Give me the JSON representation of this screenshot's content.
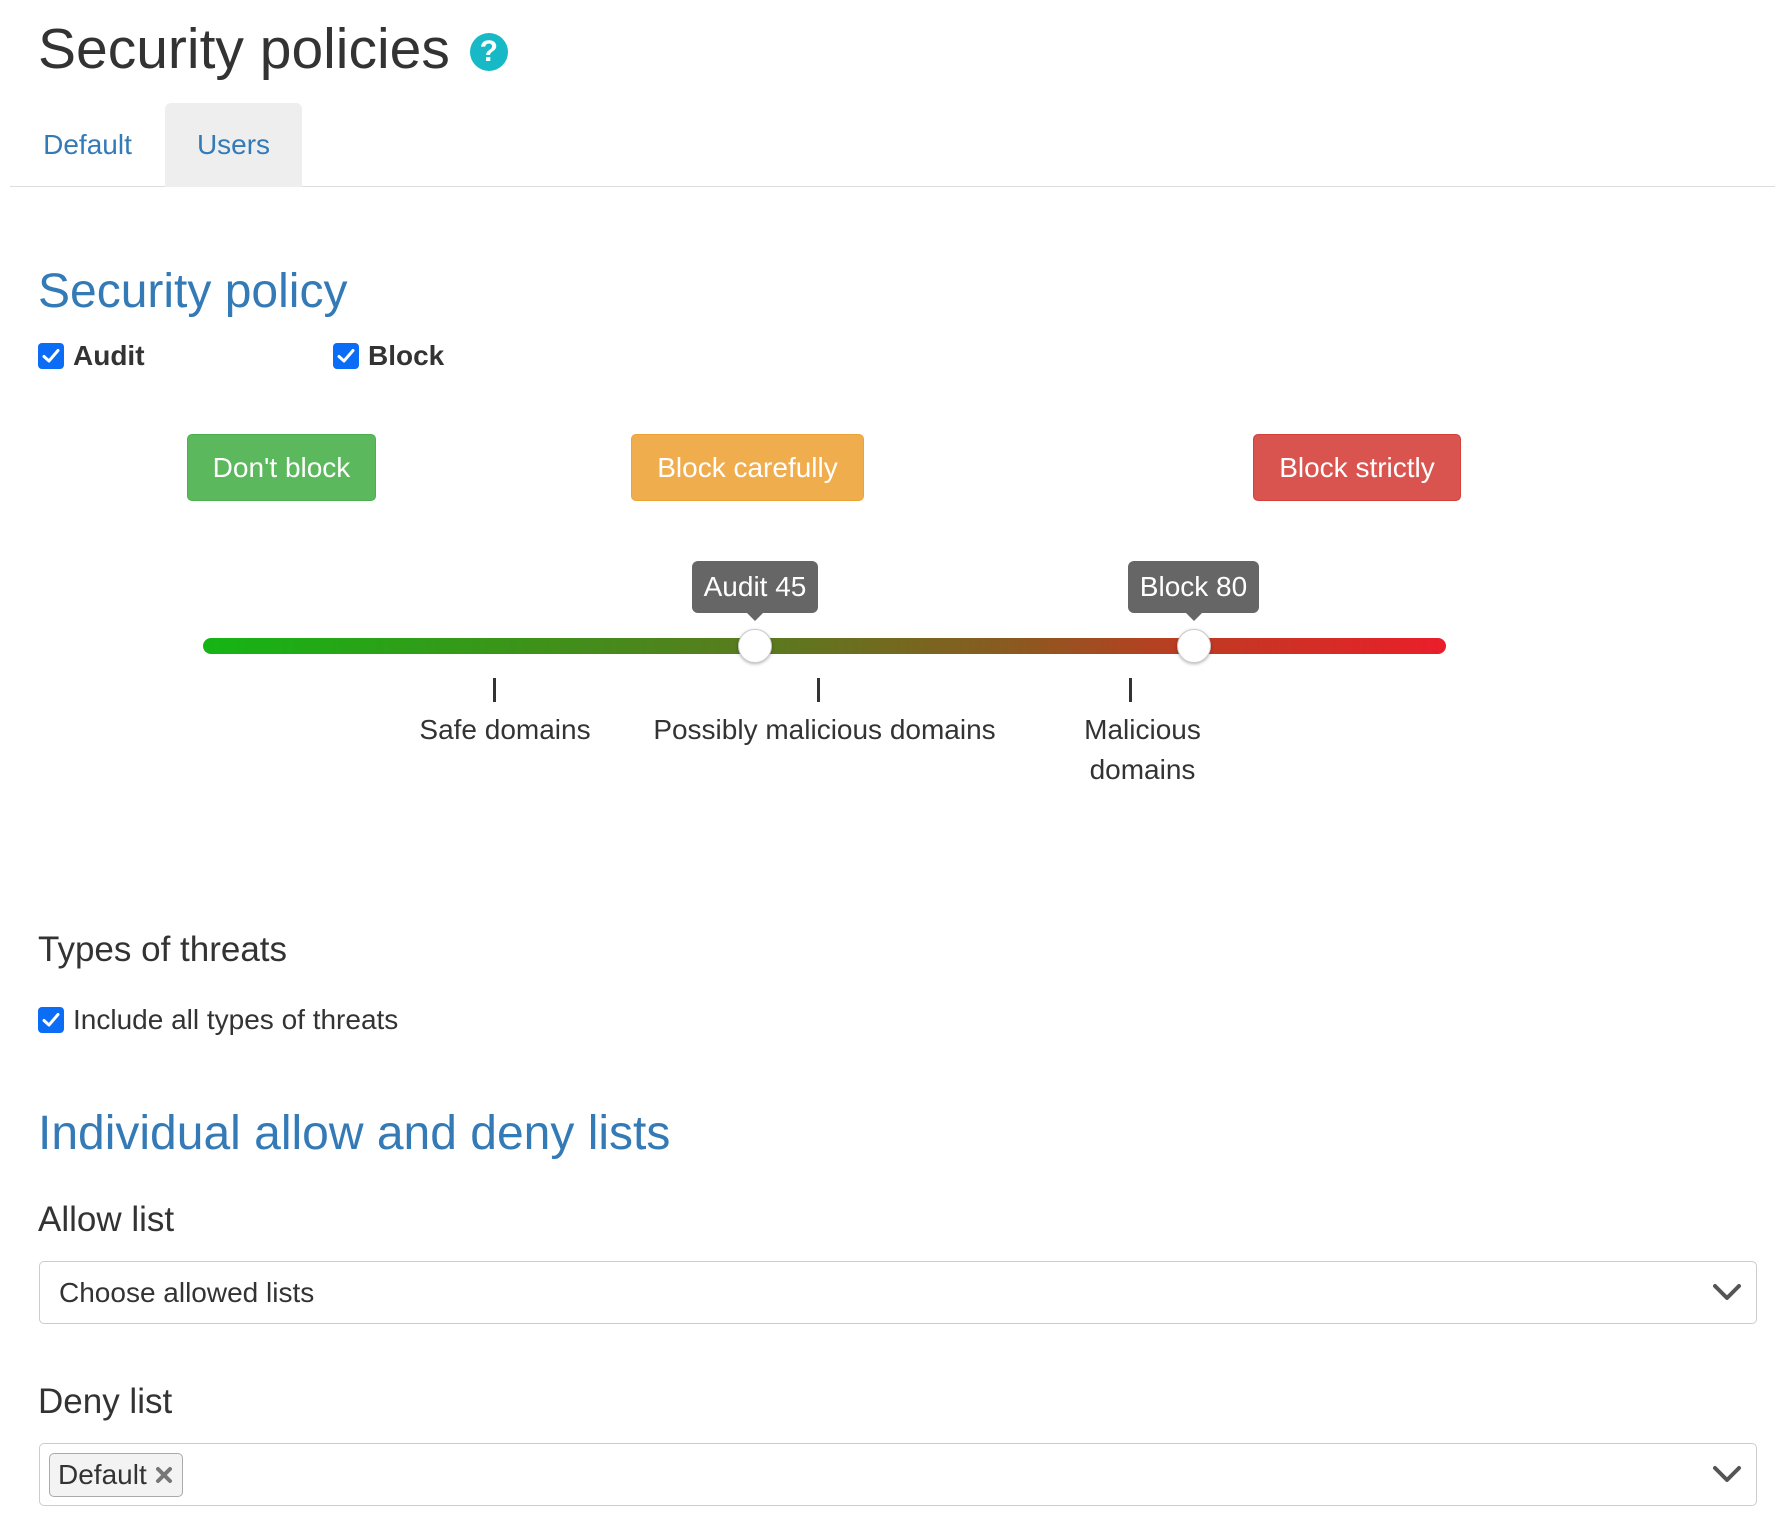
{
  "page": {
    "title": "Security policies",
    "help_icon": "question-circle-icon"
  },
  "tabs": [
    {
      "label": "Default",
      "active": false
    },
    {
      "label": "Users",
      "active": true
    }
  ],
  "security_policy": {
    "heading": "Security policy",
    "audit": {
      "label": "Audit",
      "checked": true
    },
    "block": {
      "label": "Block",
      "checked": true
    },
    "presets": {
      "dont_block": "Don't block",
      "block_carefully": "Block carefully",
      "block_strictly": "Block strictly"
    },
    "slider": {
      "audit_tooltip": "Audit 45",
      "audit_value": 45,
      "block_tooltip": "Block 80",
      "block_value": 80,
      "colors": {
        "start": "#14b514",
        "end": "#ea1e2a"
      },
      "ticks": [
        "Safe domains",
        "Possibly malicious domains",
        "Malicious domains"
      ]
    }
  },
  "threats": {
    "heading": "Types of threats",
    "include_all": {
      "label": "Include all types of threats",
      "checked": true
    }
  },
  "lists": {
    "heading": "Individual allow and deny lists",
    "allow": {
      "label": "Allow list",
      "placeholder": "Choose allowed lists"
    },
    "deny": {
      "label": "Deny list",
      "tags": [
        "Default"
      ]
    }
  },
  "colors": {
    "link": "#337ab7",
    "success": "#5cb85c",
    "warning": "#f0ad4e",
    "danger": "#d9534f",
    "checkbox": "#0b6cf5",
    "help": "#17b9c6"
  }
}
